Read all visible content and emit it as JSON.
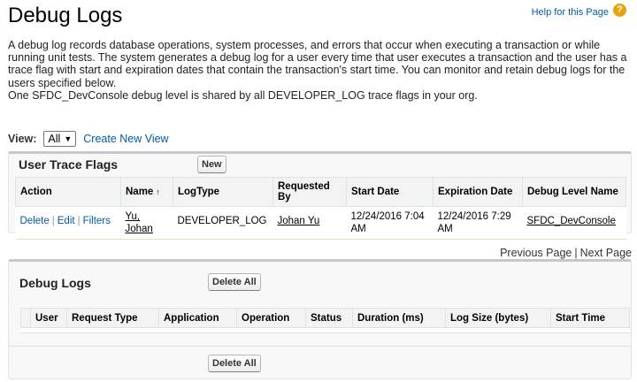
{
  "header": {
    "title": "Debug Logs",
    "help_link": "Help for this Page",
    "help_icon": "?"
  },
  "intro": {
    "paragraph": "A debug log records database operations, system processes, and errors that occur when executing a transaction or while running unit tests. The system generates a debug log for a user every time that user executes a transaction and the user has a trace flag with start and expiration dates that contain the transaction's start time. You can monitor and retain debug logs for the users specified below.",
    "note": "One SFDC_DevConsole debug level is shared by all DEVELOPER_LOG trace flags in your org."
  },
  "view": {
    "label": "View:",
    "selected": "All",
    "create_link": "Create New View"
  },
  "trace_flags": {
    "title": "User Trace Flags",
    "new_button": "New",
    "columns": [
      "Action",
      "Name",
      "LogType",
      "Requested By",
      "Start Date",
      "Expiration Date",
      "Debug Level Name"
    ],
    "sort_indicator": "↑",
    "row": {
      "action_delete": "Delete",
      "action_edit": "Edit",
      "action_filters": "Filters",
      "action_sep": "|",
      "name_line1": "Yu,",
      "name_line2": "Johan",
      "log_type": "DEVELOPER_LOG",
      "requested_by": "Johan Yu",
      "start_date": "12/24/2016 7:04 AM",
      "expiration_date": "12/24/2016 7:29 AM",
      "debug_level": "SFDC_DevConsole"
    }
  },
  "pager": {
    "previous": "Previous Page",
    "sep": "|",
    "next": "Next Page"
  },
  "debug_logs": {
    "title": "Debug Logs",
    "delete_all": "Delete All",
    "columns": [
      "User",
      "Request Type",
      "Application",
      "Operation",
      "Status",
      "Duration (ms)",
      "Log Size (bytes)",
      "Start Time"
    ]
  }
}
